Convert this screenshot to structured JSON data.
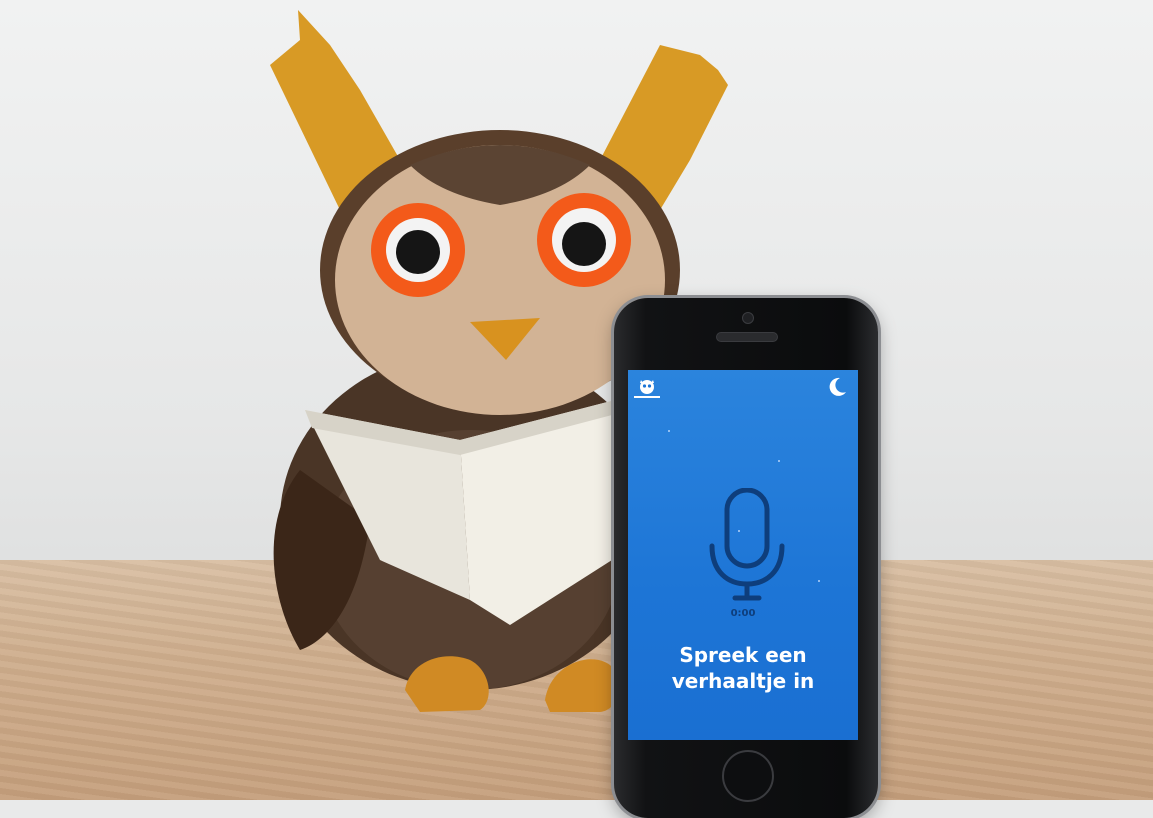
{
  "scene": {
    "subject": "owl-plush-with-book",
    "device": "smartphone"
  },
  "app": {
    "icons": {
      "logo": "owl-logo-icon",
      "mode": "moon-icon",
      "record": "microphone-icon"
    },
    "timer": "0:00",
    "prompt_line1": "Spreek een",
    "prompt_line2": "verhaaltje in",
    "colors": {
      "screen_background": "#1f78d8",
      "mic_stroke": "#0e3e7c",
      "prompt_text": "#ffffff"
    }
  }
}
